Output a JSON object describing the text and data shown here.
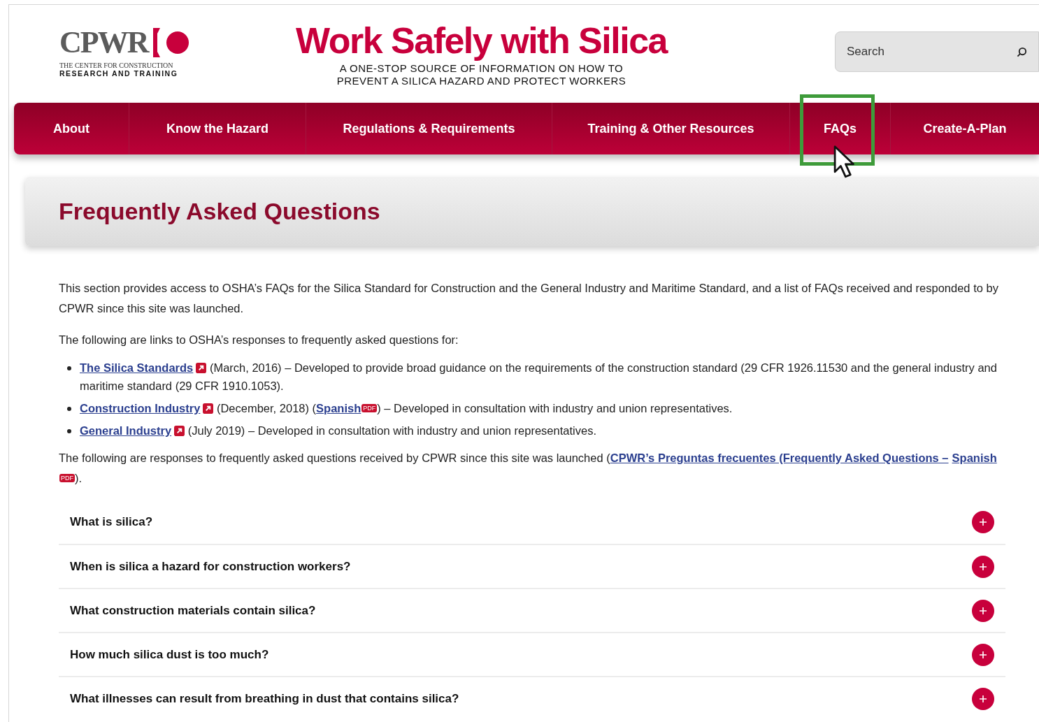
{
  "logo": {
    "wordmark": "CPWR",
    "line1": "THE CENTER FOR CONSTRUCTION",
    "line2": "RESEARCH AND TRAINING"
  },
  "site_title": "Work Safely with Silica",
  "tagline_lines": [
    "A ONE-STOP SOURCE OF INFORMATION ON HOW TO",
    "PREVENT A SILICA HAZARD AND PROTECT WORKERS"
  ],
  "search": {
    "placeholder": "Search"
  },
  "nav": [
    {
      "label": "About",
      "highlighted": false
    },
    {
      "label": "Know the Hazard",
      "highlighted": false
    },
    {
      "label": "Regulations & Requirements",
      "highlighted": false
    },
    {
      "label": "Training & Other Resources",
      "highlighted": false
    },
    {
      "label": "FAQs",
      "highlighted": true
    },
    {
      "label": "Create-A-Plan",
      "highlighted": false
    }
  ],
  "page_heading": "Frequently Asked Questions",
  "intro": "This section provides access to OSHA’s FAQs for the Silica Standard for Construction and the General Industry and Maritime Standard, and a list of FAQs received and responded to by CPWR since this site was launched.",
  "links_intro": "The following are links to OSHA’s responses to frequently asked questions for:",
  "bullets": [
    [
      {
        "kind": "link",
        "text": "The Silica Standards"
      },
      {
        "kind": "external"
      },
      {
        "kind": "text",
        "text": " (March, 2016) – Developed to provide broad guidance on the requirements of the construction standard (29 CFR 1926.11530 and the general industry and maritime standard (29 CFR 1910.1053)."
      }
    ],
    [
      {
        "kind": "link",
        "text": "Construction Industry"
      },
      {
        "kind": "external"
      },
      {
        "kind": "text",
        "text": " (December, 2018) ("
      },
      {
        "kind": "link",
        "text": "Spanish"
      },
      {
        "kind": "pdf",
        "text": "PDF"
      },
      {
        "kind": "text",
        "text": ") – Developed in consultation with industry and union representatives."
      }
    ],
    [
      {
        "kind": "link",
        "text": "General Industry"
      },
      {
        "kind": "external"
      },
      {
        "kind": "text",
        "text": " (July 2019)  – Developed in consultation with industry and union representatives."
      }
    ]
  ],
  "responses": [
    {
      "kind": "text",
      "text": "The following are responses to frequently asked questions received by CPWR since this site was launched ("
    },
    {
      "kind": "link",
      "text": "CPWR’s Preguntas frecuentes (Frequently Asked Questions –"
    },
    {
      "kind": "link",
      "text": "Spanish"
    },
    {
      "kind": "pdf",
      "text": "PDF"
    },
    {
      "kind": "text",
      "text": ")."
    }
  ],
  "faqs": [
    {
      "question": "What is silica?",
      "expanded": false
    },
    {
      "question": "When is silica a hazard for construction workers?",
      "expanded": false
    },
    {
      "question": "What construction materials contain silica?",
      "expanded": false
    },
    {
      "question": "How much silica dust is too much?",
      "expanded": false
    },
    {
      "question": "What illnesses can result from breathing in dust that contains silica?",
      "expanded": false
    }
  ]
}
